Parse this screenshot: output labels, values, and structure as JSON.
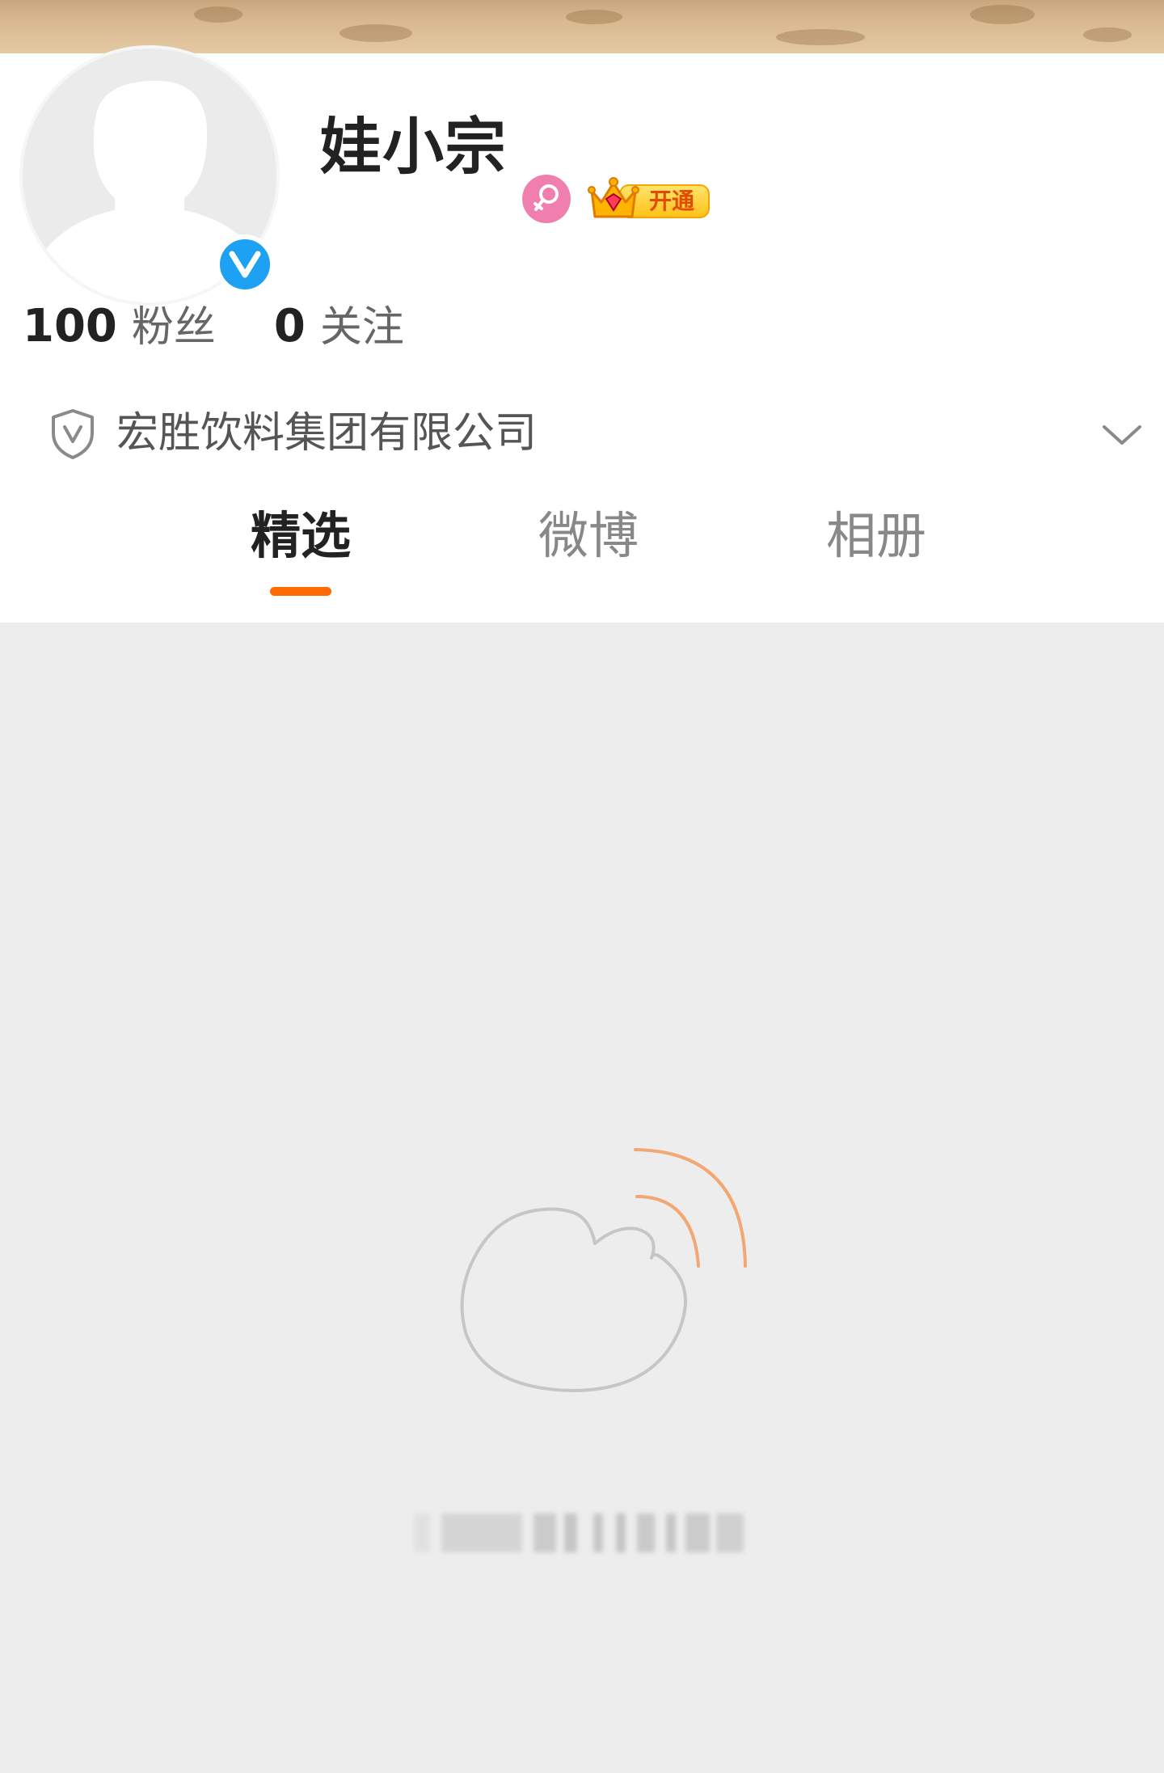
{
  "profile": {
    "username": "娃小宗",
    "verified": true,
    "gender": "female",
    "vip_badge_label": "开通"
  },
  "stats": {
    "followers_count": "100",
    "followers_label": "粉丝",
    "following_count": "0",
    "following_label": "关注"
  },
  "company": {
    "name": "宏胜饮料集团有限公司"
  },
  "tabs": [
    {
      "label": "精选",
      "active": true
    },
    {
      "label": "微博",
      "active": false
    },
    {
      "label": "相册",
      "active": false
    }
  ],
  "icons": {
    "avatar": "default-person-silhouette",
    "verified": "blue-v-badge",
    "gender": "female-symbol",
    "vip": "crown-icon",
    "company": "shield-v-icon",
    "expand": "chevron-down-icon",
    "loading": "weibo-logo-loading"
  },
  "colors": {
    "accent": "#ff6b00",
    "verified": "#1da1f2",
    "gender_female": "#f07fb0",
    "vip_gold": "#ffc21a",
    "page_background": "#ededed"
  }
}
